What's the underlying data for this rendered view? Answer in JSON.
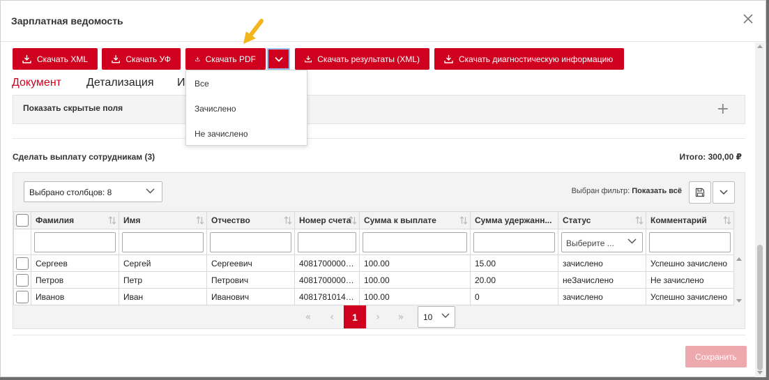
{
  "dialog": {
    "title": "Зарплатная ведомость"
  },
  "toolbar": {
    "download_xml": "Скачать XML",
    "download_uf": "Скачать УФ",
    "download_pdf": "Скачать PDF",
    "download_results": "Скачать результаты (XML)",
    "download_diag": "Скачать диагностическую информацию"
  },
  "pdf_menu": {
    "items": [
      "Все",
      "Зачислено",
      "Не зачислено"
    ]
  },
  "tabs": [
    "Документ",
    "Детализация",
    "И"
  ],
  "hidden_fields": {
    "label": "Показать скрытые поля"
  },
  "payment": {
    "title": "Сделать выплату сотрудникам (3)",
    "total": "Итого: 300,00 ₽"
  },
  "grid": {
    "columns_selected": "Выбрано столбцов: 8",
    "filter_label": "Выбран фильтр:",
    "filter_value": "Показать всё",
    "columns": [
      "Фамилия",
      "Имя",
      "Отчество",
      "Номер счета",
      "Сумма к выплате",
      "Сумма удержанн...",
      "Статус",
      "Комментарий"
    ],
    "status_filter_placeholder": "Выберите ...",
    "rows": [
      [
        "Сергеев",
        "Сергей",
        "Сергеевич",
        "40817000000...",
        "100.00",
        "15.00",
        "зачислено",
        "Успешно зачислено"
      ],
      [
        "Петров",
        "Петр",
        "Петрович",
        "40817000000...",
        "100.00",
        "20.00",
        "неЗачислено",
        "Не зачислено"
      ],
      [
        "Иванов",
        "Иван",
        "Иванович",
        "40817810140...",
        "100.00",
        "0",
        "зачислено",
        "Успешно зачислено"
      ]
    ]
  },
  "pager": {
    "first": "«",
    "prev": "‹",
    "current": "1",
    "next": "›",
    "last": "»",
    "page_size": "10"
  },
  "footer": {
    "save": "Сохранить"
  },
  "colors": {
    "accent": "#d0001f",
    "save_disabled": "#eda9ae",
    "pointer_arrow": "#f2b51d"
  }
}
